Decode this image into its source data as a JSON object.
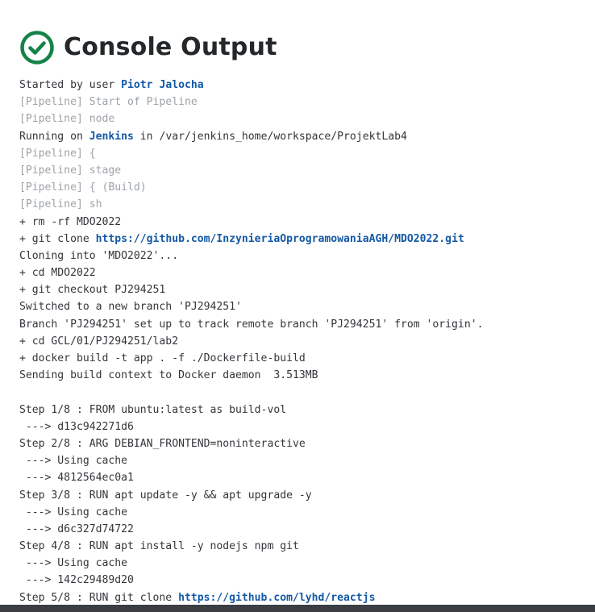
{
  "page": {
    "title": "Console Output",
    "status_icon": "check-circle-icon",
    "status_color": "#138347"
  },
  "console": {
    "lines": [
      {
        "parts": [
          {
            "t": "Started by user ",
            "s": "text"
          },
          {
            "t": "Piotr Jalocha",
            "s": "link"
          }
        ]
      },
      {
        "parts": [
          {
            "t": "[Pipeline] Start of Pipeline",
            "s": "muted"
          }
        ]
      },
      {
        "parts": [
          {
            "t": "[Pipeline] node",
            "s": "muted"
          }
        ]
      },
      {
        "parts": [
          {
            "t": "Running on ",
            "s": "text"
          },
          {
            "t": "Jenkins",
            "s": "link"
          },
          {
            "t": " in /var/jenkins_home/workspace/ProjektLab4",
            "s": "text"
          }
        ]
      },
      {
        "parts": [
          {
            "t": "[Pipeline] {",
            "s": "muted"
          }
        ]
      },
      {
        "parts": [
          {
            "t": "[Pipeline] stage",
            "s": "muted"
          }
        ]
      },
      {
        "parts": [
          {
            "t": "[Pipeline] { (Build)",
            "s": "muted"
          }
        ]
      },
      {
        "parts": [
          {
            "t": "[Pipeline] sh",
            "s": "muted"
          }
        ]
      },
      {
        "parts": [
          {
            "t": "+ rm -rf MDO2022",
            "s": "text"
          }
        ]
      },
      {
        "parts": [
          {
            "t": "+ git clone ",
            "s": "text"
          },
          {
            "t": "https://github.com/InzynieriaOprogramowaniaAGH/MDO2022.git",
            "s": "link"
          }
        ]
      },
      {
        "parts": [
          {
            "t": "Cloning into 'MDO2022'...",
            "s": "text"
          }
        ]
      },
      {
        "parts": [
          {
            "t": "+ cd MDO2022",
            "s": "text"
          }
        ]
      },
      {
        "parts": [
          {
            "t": "+ git checkout PJ294251",
            "s": "text"
          }
        ]
      },
      {
        "parts": [
          {
            "t": "Switched to a new branch 'PJ294251'",
            "s": "text"
          }
        ]
      },
      {
        "parts": [
          {
            "t": "Branch 'PJ294251' set up to track remote branch 'PJ294251' from 'origin'.",
            "s": "text"
          }
        ]
      },
      {
        "parts": [
          {
            "t": "+ cd GCL/01/PJ294251/lab2",
            "s": "text"
          }
        ]
      },
      {
        "parts": [
          {
            "t": "+ docker build -t app . -f ./Dockerfile-build",
            "s": "text"
          }
        ]
      },
      {
        "parts": [
          {
            "t": "Sending build context to Docker daemon  3.513MB",
            "s": "text"
          }
        ]
      },
      {
        "parts": [
          {
            "t": "",
            "s": "text"
          }
        ]
      },
      {
        "parts": [
          {
            "t": "Step 1/8 : FROM ubuntu:latest as build-vol",
            "s": "text"
          }
        ]
      },
      {
        "parts": [
          {
            "t": " ---> d13c942271d6",
            "s": "text"
          }
        ]
      },
      {
        "parts": [
          {
            "t": "Step 2/8 : ARG DEBIAN_FRONTEND=noninteractive",
            "s": "text"
          }
        ]
      },
      {
        "parts": [
          {
            "t": " ---> Using cache",
            "s": "text"
          }
        ]
      },
      {
        "parts": [
          {
            "t": " ---> 4812564ec0a1",
            "s": "text"
          }
        ]
      },
      {
        "parts": [
          {
            "t": "Step 3/8 : RUN apt update -y && apt upgrade -y",
            "s": "text"
          }
        ]
      },
      {
        "parts": [
          {
            "t": " ---> Using cache",
            "s": "text"
          }
        ]
      },
      {
        "parts": [
          {
            "t": " ---> d6c327d74722",
            "s": "text"
          }
        ]
      },
      {
        "parts": [
          {
            "t": "Step 4/8 : RUN apt install -y nodejs npm git",
            "s": "text"
          }
        ]
      },
      {
        "parts": [
          {
            "t": " ---> Using cache",
            "s": "text"
          }
        ]
      },
      {
        "parts": [
          {
            "t": " ---> 142c29489d20",
            "s": "text"
          }
        ]
      },
      {
        "parts": [
          {
            "t": "Step 5/8 : RUN git clone ",
            "s": "text"
          },
          {
            "t": "https://github.com/lyhd/reactjs",
            "s": "link"
          }
        ]
      }
    ]
  }
}
